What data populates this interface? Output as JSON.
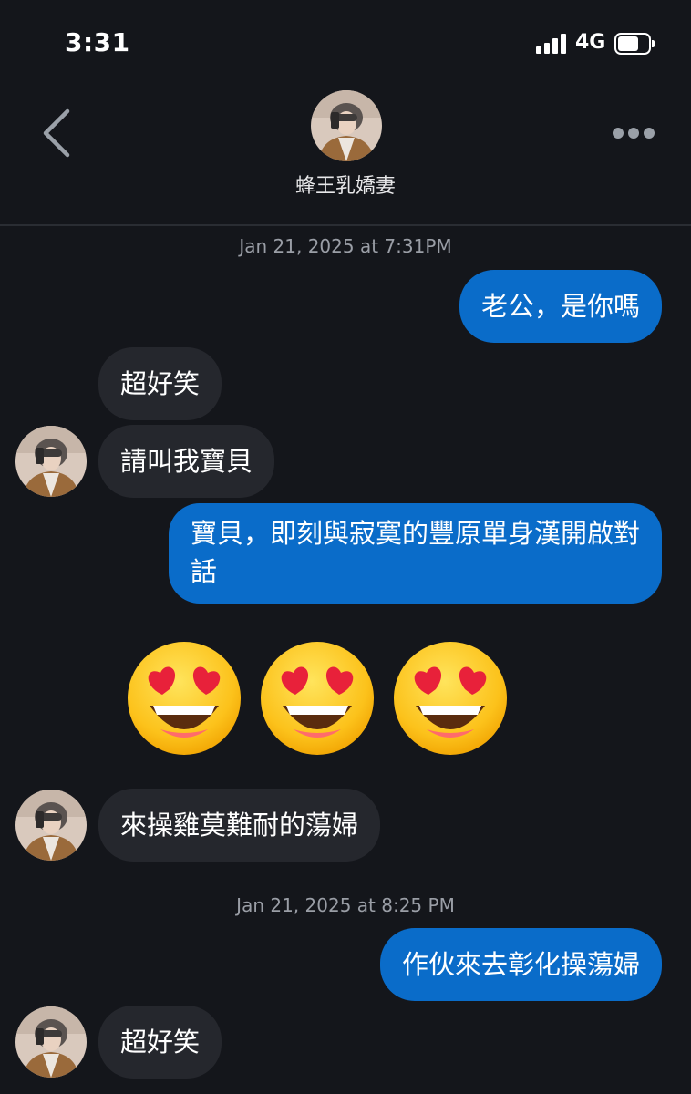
{
  "status_bar": {
    "time": "3:31",
    "network": "4G"
  },
  "header": {
    "contact_name": "蜂王乳嬌妻"
  },
  "messages": {
    "ts1": "Jan 21, 2025 at 7:31PM",
    "m1": "老公，是你嗎",
    "m2": "超好笑",
    "m3": "請叫我寶貝",
    "m4": "寶貝，即刻與寂寞的豐原單身漢開啟對話",
    "m5_emoji": "😍😍😍",
    "m6": "來操雞莫難耐的蕩婦",
    "ts2": "Jan 21, 2025 at 8:25 PM",
    "m7": "作伙來去彰化操蕩婦",
    "m8": "超好笑"
  },
  "colors": {
    "background": "#14161b",
    "incoming_bubble": "#25272d",
    "outgoing_bubble": "#0a6cc9",
    "timestamp_text": "#9a9ea6"
  },
  "icons": [
    "signal-icon",
    "battery-icon",
    "back-chevron-icon",
    "more-dots-icon",
    "heart-eyes-emoji-icon",
    "avatar"
  ]
}
